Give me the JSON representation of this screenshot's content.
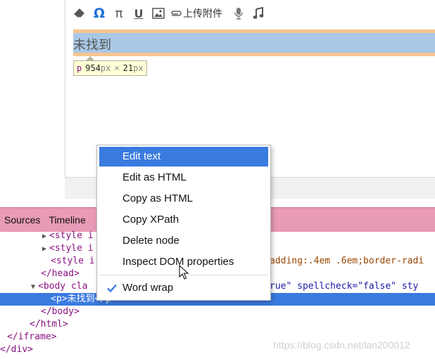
{
  "toolbar": {
    "eraser_icon": "eraser-icon",
    "omega": "Ω",
    "pi": "π",
    "underline": "U",
    "image_icon": "image-icon",
    "attach_label": "上传附件",
    "mic_icon": "microphone-icon",
    "music_icon": "music-icon"
  },
  "editor": {
    "paragraph_text": "未找到",
    "size_tooltip": {
      "tag": "p",
      "width": "954",
      "x": "×",
      "height": "21",
      "unit": "px"
    }
  },
  "devtools": {
    "tabs": [
      "Sources",
      "Timeline"
    ],
    "lines": [
      {
        "indent": 60,
        "tri": "▶",
        "text": "<style i"
      },
      {
        "indent": 60,
        "tri": "▶",
        "text": "<style i"
      },
      {
        "indent": 72,
        "tri": "",
        "text": "<style i",
        "rest": "adding:.4em .6em;border-radi"
      },
      {
        "indent": 58,
        "tri": "",
        "text": "</head>"
      },
      {
        "indent": 44,
        "tri": "▼",
        "text": "<body cla",
        "rest_name": "",
        "rest": "rue\" spellcheck=\"false\" sty"
      },
      {
        "indent": 72,
        "tri": "",
        "text": "<p>未找到</p>",
        "selected": true
      },
      {
        "indent": 58,
        "tri": "",
        "text": "</body>"
      },
      {
        "indent": 42,
        "tri": "",
        "text": "</html>"
      },
      {
        "indent": 10,
        "tri": "",
        "text": "</iframe>"
      },
      {
        "indent": 0,
        "tri": "",
        "text": "</div>"
      }
    ]
  },
  "context_menu": {
    "items": [
      "Edit text",
      "Edit as HTML",
      "Copy as HTML",
      "Copy XPath",
      "Delete node",
      "Inspect DOM properties"
    ],
    "checked_item": "Word wrap"
  },
  "watermark": "https://blog.csdn.net/lan200012",
  "colors": {
    "selection": "#3a7be0",
    "devtools_tab_bar": "#e99ab6",
    "padding_highlight": "#f7c58d",
    "content_highlight": "#a9c8e6",
    "accent": "#1e6fd9"
  }
}
